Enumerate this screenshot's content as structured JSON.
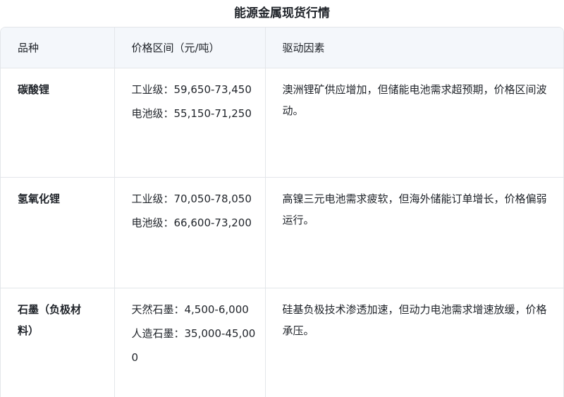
{
  "title": "能源金属现货行情",
  "table": {
    "headers": [
      "品种",
      "价格区间（元/吨）",
      "驱动因素"
    ],
    "rows": [
      {
        "product": "碳酸锂",
        "prices": [
          "工业级：59,650-73,450",
          "电池级：55,150-71,250"
        ],
        "driver": "澳洲锂矿供应增加，但储能电池需求超预期，价格区间波动。"
      },
      {
        "product": "氢氧化锂",
        "prices": [
          "工业级：70,050-78,050",
          "电池级：66,600-73,200"
        ],
        "driver": "高镍三元电池需求疲软，但海外储能订单增长，价格偏弱运行。"
      },
      {
        "product": "石墨（负极材料）",
        "prices": [
          "天然石墨：4,500-6,000",
          "人造石墨：35,000-45,000"
        ],
        "driver": "硅基负极技术渗透加速，但动力电池需求增速放缓，价格承压。"
      }
    ]
  }
}
